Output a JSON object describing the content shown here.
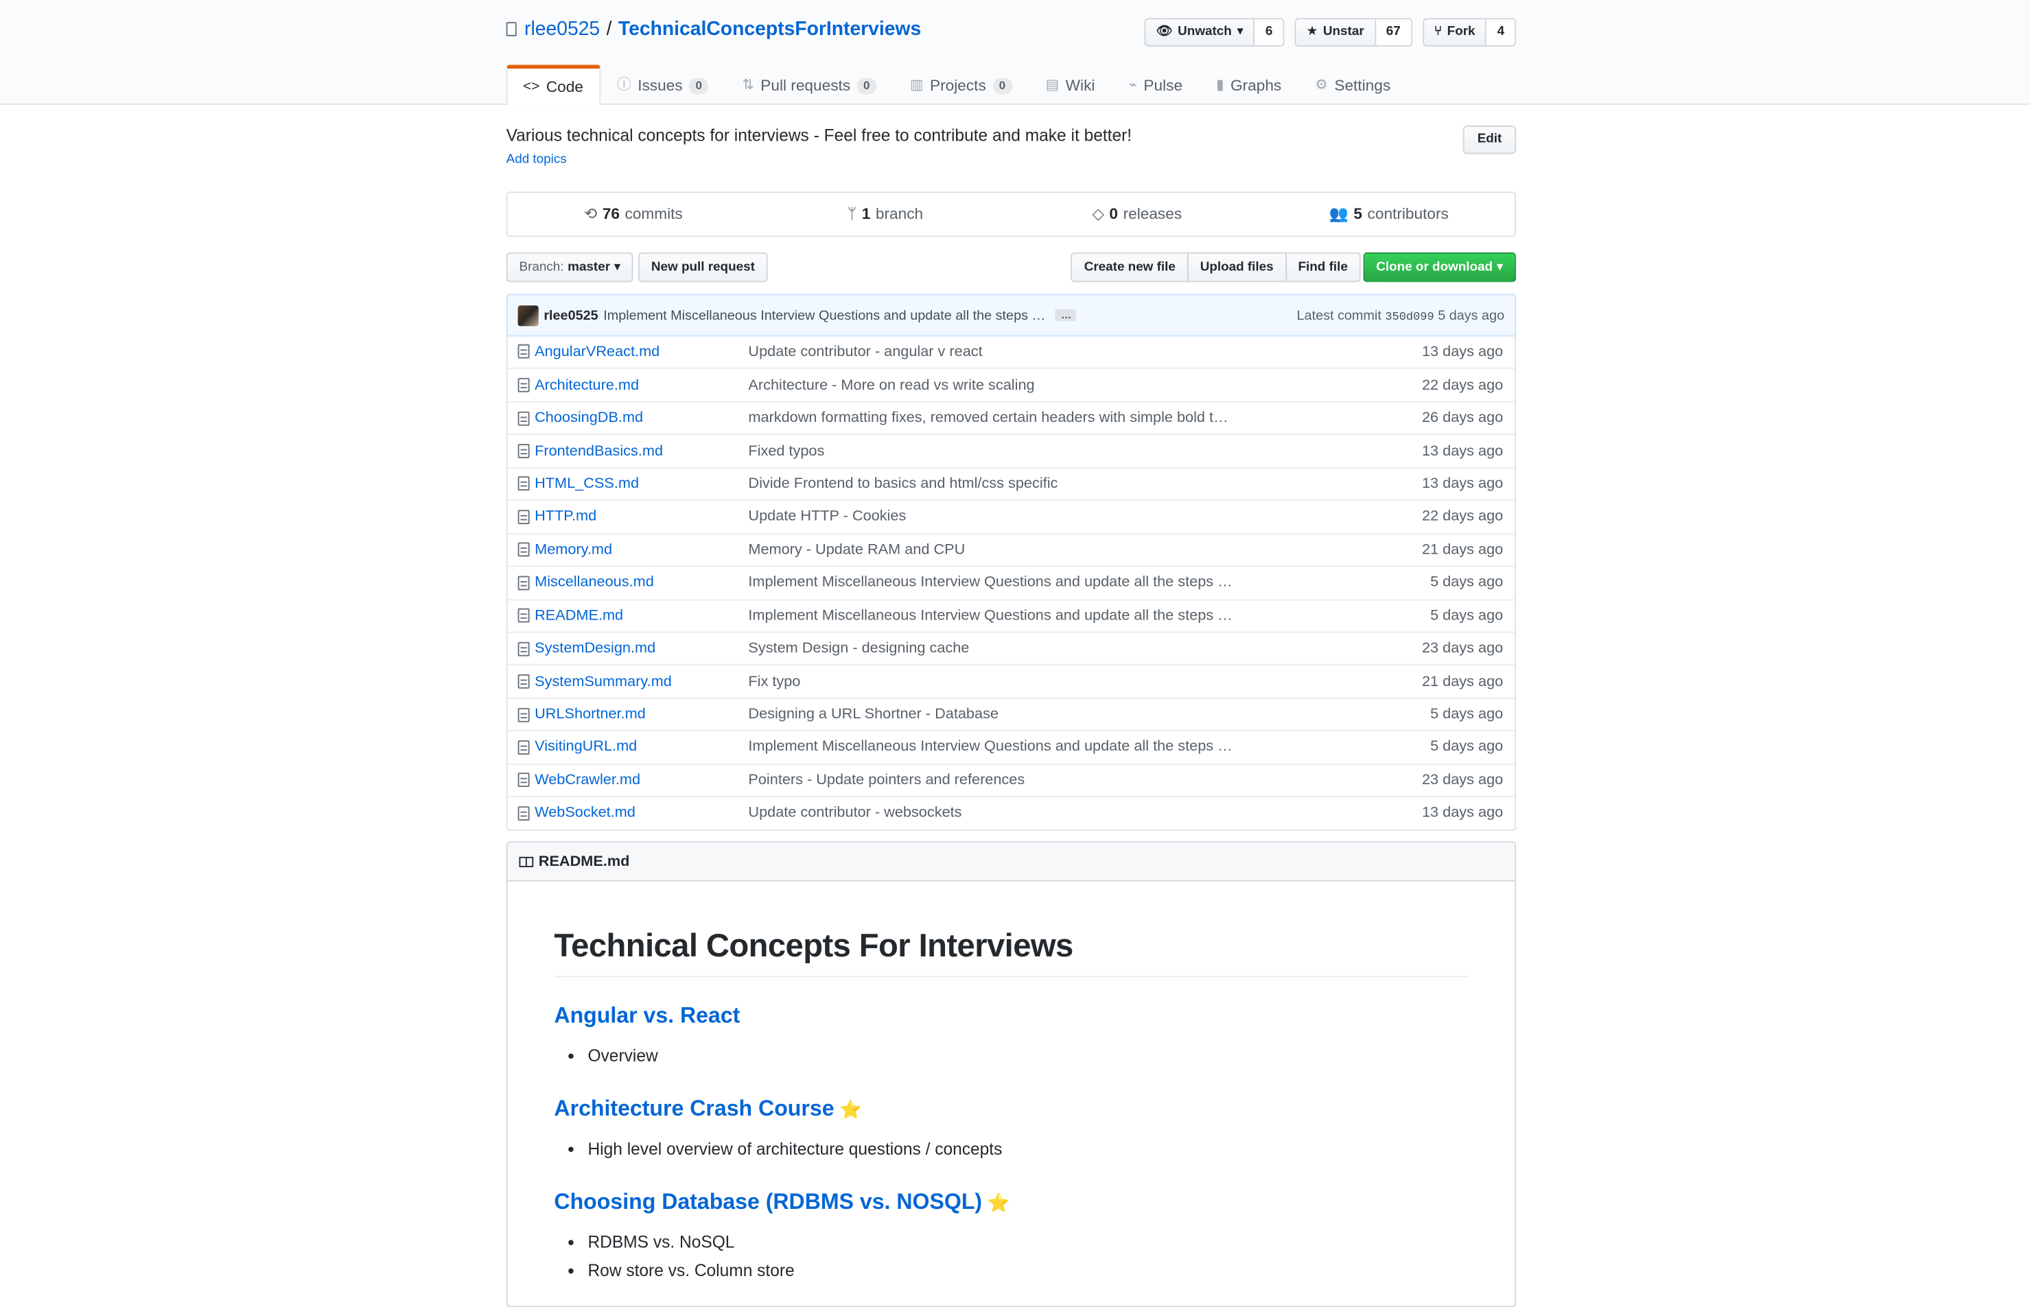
{
  "repo": {
    "owner": "rlee0525",
    "separator": "/",
    "name": "TechnicalConceptsForInterviews"
  },
  "actions": {
    "watch": {
      "label": "Unwatch",
      "count": "6"
    },
    "star": {
      "label": "Unstar",
      "count": "67"
    },
    "fork": {
      "label": "Fork",
      "count": "4"
    }
  },
  "tabs": [
    {
      "label": "Code",
      "icon": "code-icon"
    },
    {
      "label": "Issues",
      "count": "0",
      "icon": "issue-icon"
    },
    {
      "label": "Pull requests",
      "count": "0",
      "icon": "pull-request-icon"
    },
    {
      "label": "Projects",
      "count": "0",
      "icon": "project-icon"
    },
    {
      "label": "Wiki",
      "icon": "book-icon"
    },
    {
      "label": "Pulse",
      "icon": "pulse-icon"
    },
    {
      "label": "Graphs",
      "icon": "graph-icon"
    },
    {
      "label": "Settings",
      "icon": "gear-icon"
    }
  ],
  "description": "Various technical concepts for interviews - Feel free to contribute and make it better!",
  "add_topics": "Add topics",
  "edit_label": "Edit",
  "summary": {
    "commits": {
      "count": "76",
      "label": "commits"
    },
    "branches": {
      "count": "1",
      "label": "branch"
    },
    "releases": {
      "count": "0",
      "label": "releases"
    },
    "contributors": {
      "count": "5",
      "label": "contributors"
    }
  },
  "file_nav": {
    "branch_prefix": "Branch:",
    "branch": "master",
    "new_pr": "New pull request",
    "create_file": "Create new file",
    "upload_files": "Upload files",
    "find_file": "Find file",
    "clone": "Clone or download"
  },
  "latest_commit": {
    "author": "rlee0525",
    "message": "Implement Miscellaneous Interview Questions and update all the steps …",
    "ellipsis": "…",
    "prefix": "Latest commit",
    "sha": "350d099",
    "age": "5 days ago"
  },
  "files": [
    {
      "name": "AngularVReact.md",
      "message": "Update contributor - angular v react",
      "age": "13 days ago"
    },
    {
      "name": "Architecture.md",
      "message": "Architecture - More on read vs write scaling",
      "age": "22 days ago"
    },
    {
      "name": "ChoosingDB.md",
      "message": "markdown formatting fixes, removed certain headers with simple bold t…",
      "age": "26 days ago"
    },
    {
      "name": "FrontendBasics.md",
      "message": "Fixed typos",
      "age": "13 days ago"
    },
    {
      "name": "HTML_CSS.md",
      "message": "Divide Frontend to basics and html/css specific",
      "age": "13 days ago"
    },
    {
      "name": "HTTP.md",
      "message": "Update HTTP - Cookies",
      "age": "22 days ago"
    },
    {
      "name": "Memory.md",
      "message": "Memory - Update RAM and CPU",
      "age": "21 days ago"
    },
    {
      "name": "Miscellaneous.md",
      "message": "Implement Miscellaneous Interview Questions and update all the steps …",
      "age": "5 days ago"
    },
    {
      "name": "README.md",
      "message": "Implement Miscellaneous Interview Questions and update all the steps …",
      "age": "5 days ago"
    },
    {
      "name": "SystemDesign.md",
      "message": "System Design - designing cache",
      "age": "23 days ago"
    },
    {
      "name": "SystemSummary.md",
      "message": "Fix typo",
      "age": "21 days ago"
    },
    {
      "name": "URLShortner.md",
      "message": "Designing a URL Shortner - Database",
      "age": "5 days ago"
    },
    {
      "name": "VisitingURL.md",
      "message": "Implement Miscellaneous Interview Questions and update all the steps …",
      "age": "5 days ago"
    },
    {
      "name": "WebCrawler.md",
      "message": "Pointers - Update pointers and references",
      "age": "23 days ago"
    },
    {
      "name": "WebSocket.md",
      "message": "Update contributor - websockets",
      "age": "13 days ago"
    }
  ],
  "readme": {
    "filename": "README.md",
    "title": "Technical Concepts For Interviews",
    "sections": [
      {
        "heading": "Angular vs. React",
        "star": false,
        "items": [
          "Overview"
        ]
      },
      {
        "heading": "Architecture Crash Course",
        "star": true,
        "items": [
          "High level overview of architecture questions / concepts"
        ]
      },
      {
        "heading": "Choosing Database (RDBMS vs. NOSQL)",
        "star": true,
        "items": [
          "RDBMS vs. NoSQL",
          "Row store vs. Column store"
        ]
      }
    ]
  },
  "colors": {
    "link": "#0366d6",
    "primary": "#28a745",
    "tab_accent": "#e36209",
    "commit_bg": "#f1f8ff"
  }
}
